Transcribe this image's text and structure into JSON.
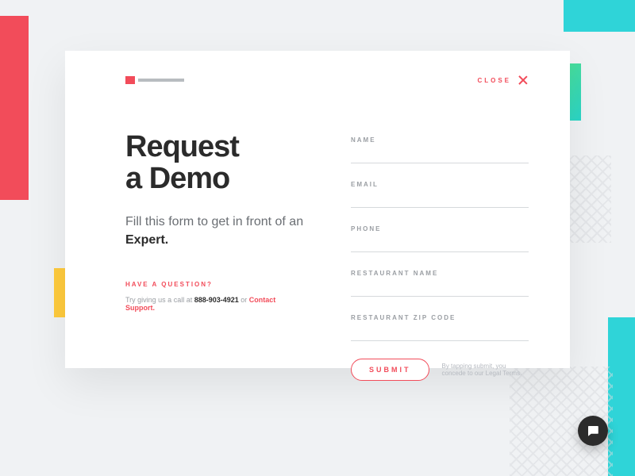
{
  "close_label": "CLOSE",
  "title_line1": "Request",
  "title_line2": "a Demo",
  "subtitle_pre": "Fill this form to get in front of an ",
  "subtitle_expert": "Expert.",
  "question_heading": "HAVE A QUESTION?",
  "support_pre": "Try giving us a call at ",
  "support_phone": "888-903-4921",
  "support_mid": " or ",
  "support_link": "Contact Support.",
  "fields": {
    "name": "NAME",
    "email": "EMAIL",
    "phone": "PHONE",
    "restaurant_name": "RESTAURANT NAME",
    "restaurant_zip": "RESTAURANT ZIP CODE"
  },
  "submit_label": "SUBMIT",
  "legal_text": "By tapping submit, you concede to our Legal Terms.",
  "colors": {
    "accent": "#f24c5a",
    "cyan": "#2fd4d8",
    "yellow": "#ffcb3d"
  }
}
